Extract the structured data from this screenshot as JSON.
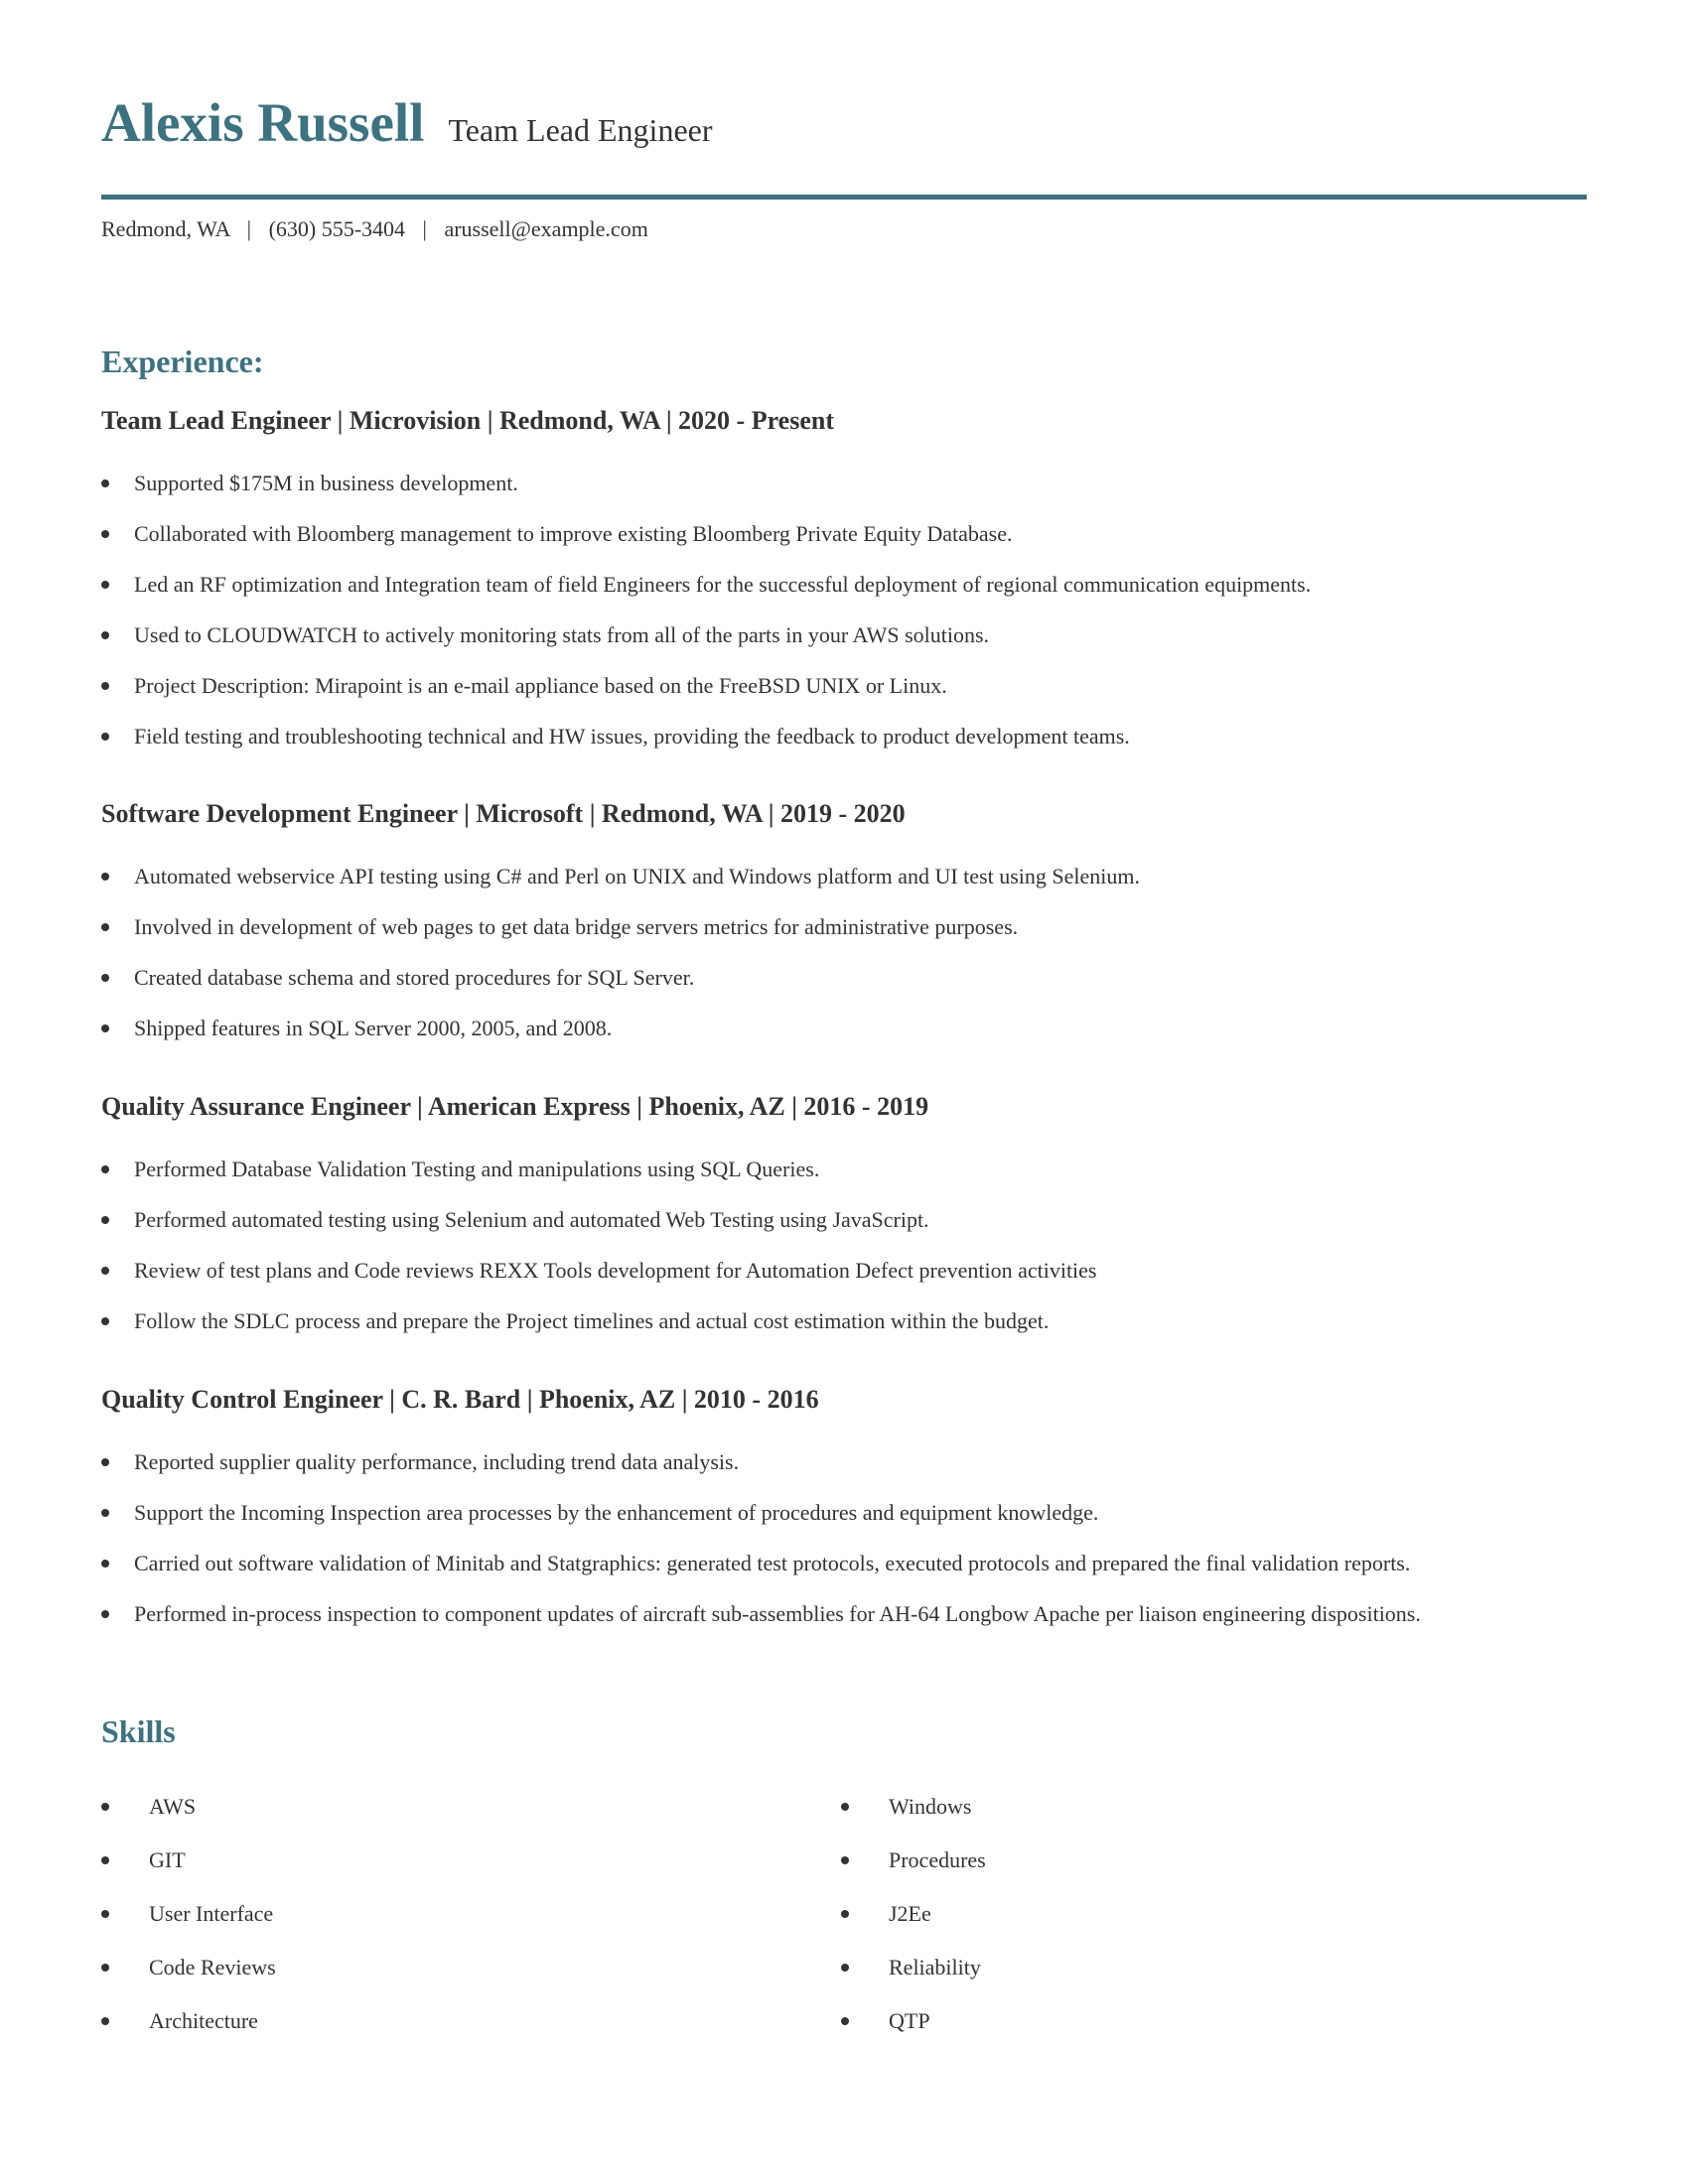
{
  "header": {
    "name": "Alexis Russell",
    "title": "Team Lead Engineer",
    "accent_color": "#3d7280"
  },
  "contact": {
    "location": "Redmond, WA",
    "phone": "(630) 555-3404",
    "email": "arussell@example.com",
    "separator": "|"
  },
  "experience": {
    "heading": "Experience:",
    "jobs": [
      {
        "title": "Team Lead Engineer | Microvision | Redmond, WA |  2020 - Present",
        "bullets": [
          "Supported $175M in business development.",
          "Collaborated with Bloomberg management to improve existing Bloomberg Private Equity Database.",
          "Led an RF optimization and Integration team of field Engineers for the successful deployment of regional communication equipments.",
          "Used to CLOUDWATCH to actively monitoring stats from all of the parts in your AWS solutions.",
          "Project Description: Mirapoint is an e-mail appliance based on the FreeBSD UNIX or Linux.",
          "Field testing and troubleshooting technical and HW issues, providing the feedback to product development teams."
        ]
      },
      {
        "title": "Software Development Engineer | Microsoft | Redmond, WA |  2019 - 2020",
        "bullets": [
          "Automated webservice API testing using C# and Perl on UNIX and Windows platform and UI test using Selenium.",
          "Involved in development of web pages to get data bridge servers metrics for administrative purposes.",
          "Created database schema and stored procedures for SQL Server.",
          "Shipped features in SQL Server 2000, 2005, and 2008."
        ]
      },
      {
        "title": "Quality Assurance Engineer | American Express | Phoenix, AZ |  2016 - 2019",
        "bullets": [
          "Performed Database Validation Testing and manipulations using SQL Queries.",
          "Performed automated testing using Selenium and automated Web Testing using JavaScript.",
          "Review of test plans and Code reviews REXX Tools development for Automation Defect prevention activities",
          "Follow the SDLC process and prepare the Project timelines and actual cost estimation within the budget."
        ]
      },
      {
        "title": "Quality Control Engineer | C. R. Bard | Phoenix, AZ |  2010 - 2016",
        "bullets": [
          "Reported supplier quality performance, including trend data analysis.",
          "Support the Incoming Inspection area processes by the enhancement of procedures and equipment knowledge.",
          "Carried out software validation of Minitab and Statgraphics: generated test protocols, executed protocols and prepared the final validation reports.",
          "Performed in-process inspection to component updates of aircraft sub-assemblies for AH-64 Longbow Apache per liaison engineering dispositions."
        ]
      }
    ]
  },
  "skills": {
    "heading": "Skills",
    "left": [
      "AWS",
      "GIT",
      "User Interface",
      "Code Reviews",
      "Architecture"
    ],
    "right": [
      "Windows",
      "Procedures",
      "J2Ee",
      "Reliability",
      "QTP"
    ]
  }
}
